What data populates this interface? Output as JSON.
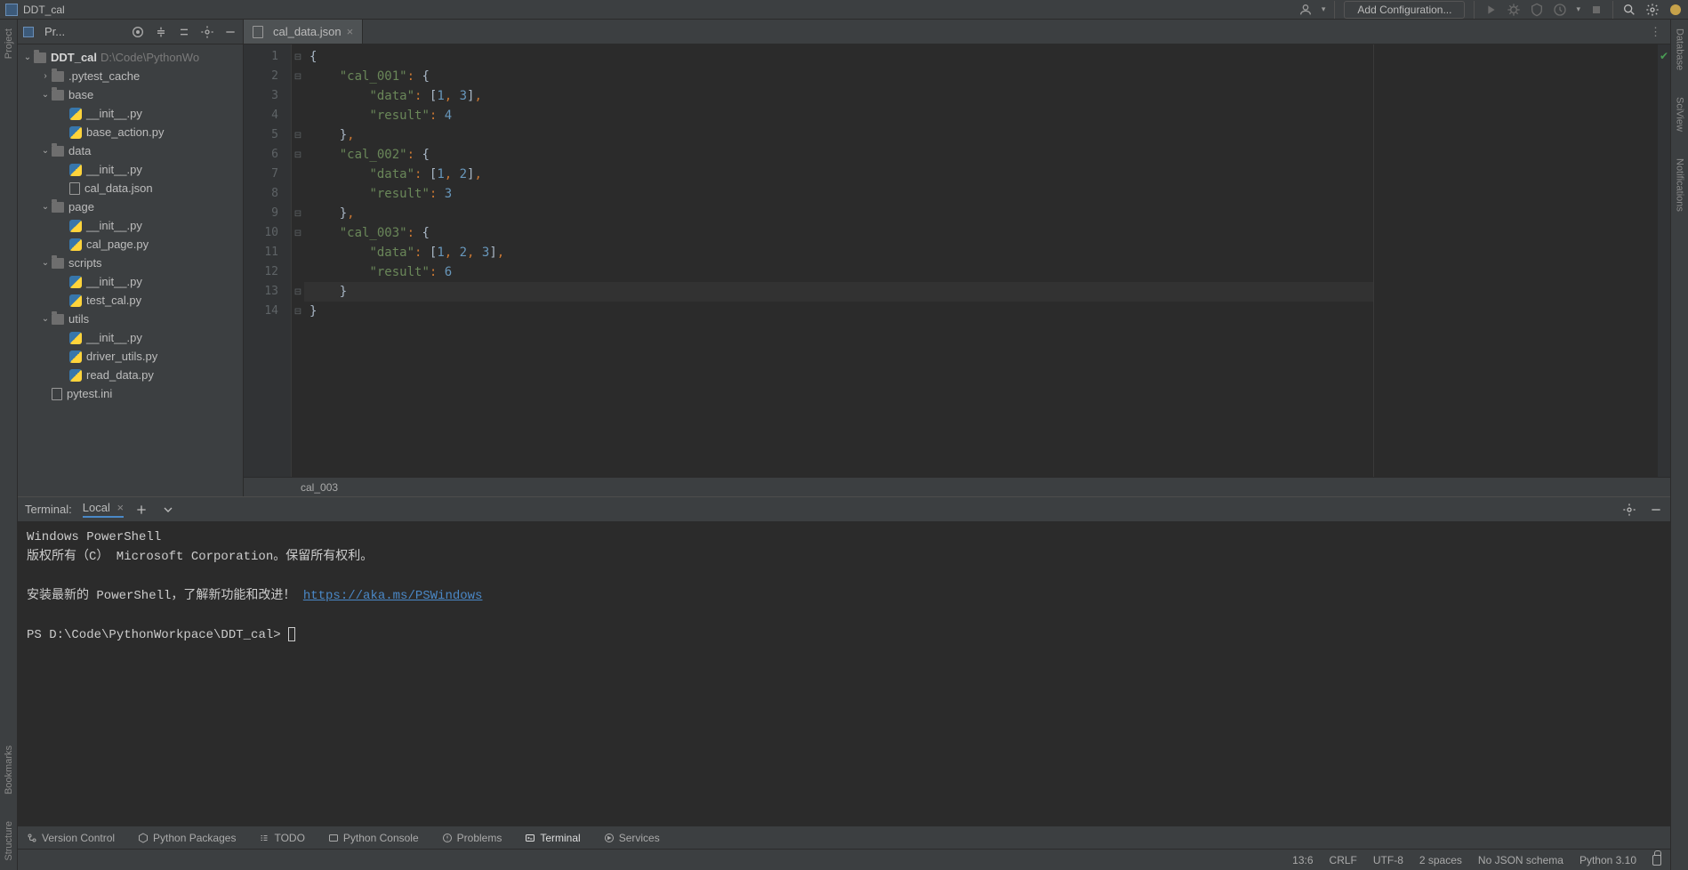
{
  "window": {
    "title": "DDT_cal"
  },
  "toolbar": {
    "add_config": "Add Configuration..."
  },
  "left_tool_labels": {
    "project": "Project",
    "bookmarks": "Bookmarks",
    "structure": "Structure"
  },
  "right_tool_labels": {
    "database": "Database",
    "sciview": "SciView",
    "notifications": "Notifications"
  },
  "project_panel": {
    "header_label": "Pr...",
    "root_name": "DDT_cal",
    "root_path": "D:\\Code\\PythonWo",
    "tree": [
      {
        "indent": 1,
        "chev": "›",
        "icon": "folder",
        "label": ".pytest_cache"
      },
      {
        "indent": 1,
        "chev": "⌄",
        "icon": "folder",
        "label": "base"
      },
      {
        "indent": 2,
        "chev": "",
        "icon": "py",
        "label": "__init__.py"
      },
      {
        "indent": 2,
        "chev": "",
        "icon": "py",
        "label": "base_action.py"
      },
      {
        "indent": 1,
        "chev": "⌄",
        "icon": "folder",
        "label": "data"
      },
      {
        "indent": 2,
        "chev": "",
        "icon": "py",
        "label": "__init__.py"
      },
      {
        "indent": 2,
        "chev": "",
        "icon": "json",
        "label": "cal_data.json"
      },
      {
        "indent": 1,
        "chev": "⌄",
        "icon": "folder",
        "label": "page"
      },
      {
        "indent": 2,
        "chev": "",
        "icon": "py",
        "label": "__init__.py"
      },
      {
        "indent": 2,
        "chev": "",
        "icon": "py",
        "label": "cal_page.py"
      },
      {
        "indent": 1,
        "chev": "⌄",
        "icon": "folder",
        "label": "scripts"
      },
      {
        "indent": 2,
        "chev": "",
        "icon": "py",
        "label": "__init__.py"
      },
      {
        "indent": 2,
        "chev": "",
        "icon": "py",
        "label": "test_cal.py"
      },
      {
        "indent": 1,
        "chev": "⌄",
        "icon": "folder",
        "label": "utils"
      },
      {
        "indent": 2,
        "chev": "",
        "icon": "py",
        "label": "__init__.py"
      },
      {
        "indent": 2,
        "chev": "",
        "icon": "py",
        "label": "driver_utils.py"
      },
      {
        "indent": 2,
        "chev": "",
        "icon": "py",
        "label": "read_data.py"
      },
      {
        "indent": 1,
        "chev": "",
        "icon": "ini",
        "label": "pytest.ini"
      }
    ]
  },
  "editor": {
    "tab_filename": "cal_data.json",
    "line_count": 14,
    "current_line": 13,
    "breadcrumb": "cal_003",
    "code_tokens": [
      [
        [
          "brace",
          "{"
        ]
      ],
      [
        [
          "sp",
          "    "
        ],
        [
          "key",
          "\"cal_001\""
        ],
        [
          "punct",
          ": "
        ],
        [
          "brace",
          "{"
        ]
      ],
      [
        [
          "sp",
          "        "
        ],
        [
          "key",
          "\"data\""
        ],
        [
          "punct",
          ": "
        ],
        [
          "bracket",
          "["
        ],
        [
          "num",
          "1"
        ],
        [
          "punct",
          ", "
        ],
        [
          "num",
          "3"
        ],
        [
          "bracket",
          "]"
        ],
        [
          "punct",
          ","
        ]
      ],
      [
        [
          "sp",
          "        "
        ],
        [
          "key",
          "\"result\""
        ],
        [
          "punct",
          ": "
        ],
        [
          "num",
          "4"
        ]
      ],
      [
        [
          "sp",
          "    "
        ],
        [
          "brace",
          "}"
        ],
        [
          "punct",
          ","
        ]
      ],
      [
        [
          "sp",
          "    "
        ],
        [
          "key",
          "\"cal_002\""
        ],
        [
          "punct",
          ": "
        ],
        [
          "brace",
          "{"
        ]
      ],
      [
        [
          "sp",
          "        "
        ],
        [
          "key",
          "\"data\""
        ],
        [
          "punct",
          ": "
        ],
        [
          "bracket",
          "["
        ],
        [
          "num",
          "1"
        ],
        [
          "punct",
          ", "
        ],
        [
          "num",
          "2"
        ],
        [
          "bracket",
          "]"
        ],
        [
          "punct",
          ","
        ]
      ],
      [
        [
          "sp",
          "        "
        ],
        [
          "key",
          "\"result\""
        ],
        [
          "punct",
          ": "
        ],
        [
          "num",
          "3"
        ]
      ],
      [
        [
          "sp",
          "    "
        ],
        [
          "brace",
          "}"
        ],
        [
          "punct",
          ","
        ]
      ],
      [
        [
          "sp",
          "    "
        ],
        [
          "key",
          "\"cal_003\""
        ],
        [
          "punct",
          ": "
        ],
        [
          "brace",
          "{"
        ]
      ],
      [
        [
          "sp",
          "        "
        ],
        [
          "key",
          "\"data\""
        ],
        [
          "punct",
          ": "
        ],
        [
          "bracket",
          "["
        ],
        [
          "num",
          "1"
        ],
        [
          "punct",
          ", "
        ],
        [
          "num",
          "2"
        ],
        [
          "punct",
          ", "
        ],
        [
          "num",
          "3"
        ],
        [
          "bracket",
          "]"
        ],
        [
          "punct",
          ","
        ]
      ],
      [
        [
          "sp",
          "        "
        ],
        [
          "key",
          "\"result\""
        ],
        [
          "punct",
          ": "
        ],
        [
          "num",
          "6"
        ]
      ],
      [
        [
          "sp",
          "    "
        ],
        [
          "brace",
          "}"
        ]
      ],
      [
        [
          "brace",
          "}"
        ]
      ]
    ],
    "fold_marks": [
      "⊟",
      "⊟",
      "",
      "",
      "⊟",
      "⊟",
      "",
      "",
      "⊟",
      "⊟",
      "",
      "",
      "⊟",
      "⊟"
    ]
  },
  "terminal": {
    "header_label": "Terminal:",
    "tab_label": "Local",
    "lines": [
      "Windows PowerShell",
      "版权所有（C） Microsoft Corporation。保留所有权利。",
      "",
      "安装最新的 PowerShell，了解新功能和改进！ "
    ],
    "link_text": "https://aka.ms/PSWindows",
    "prompt": "PS D:\\Code\\PythonWorkpace\\DDT_cal> "
  },
  "bottom_tabs": {
    "version_control": "Version Control",
    "python_packages": "Python Packages",
    "todo": "TODO",
    "python_console": "Python Console",
    "problems": "Problems",
    "terminal": "Terminal",
    "services": "Services"
  },
  "status": {
    "pos": "13:6",
    "eol": "CRLF",
    "encoding": "UTF-8",
    "indent": "2 spaces",
    "schema": "No JSON schema",
    "interpreter": "Python 3.10"
  }
}
